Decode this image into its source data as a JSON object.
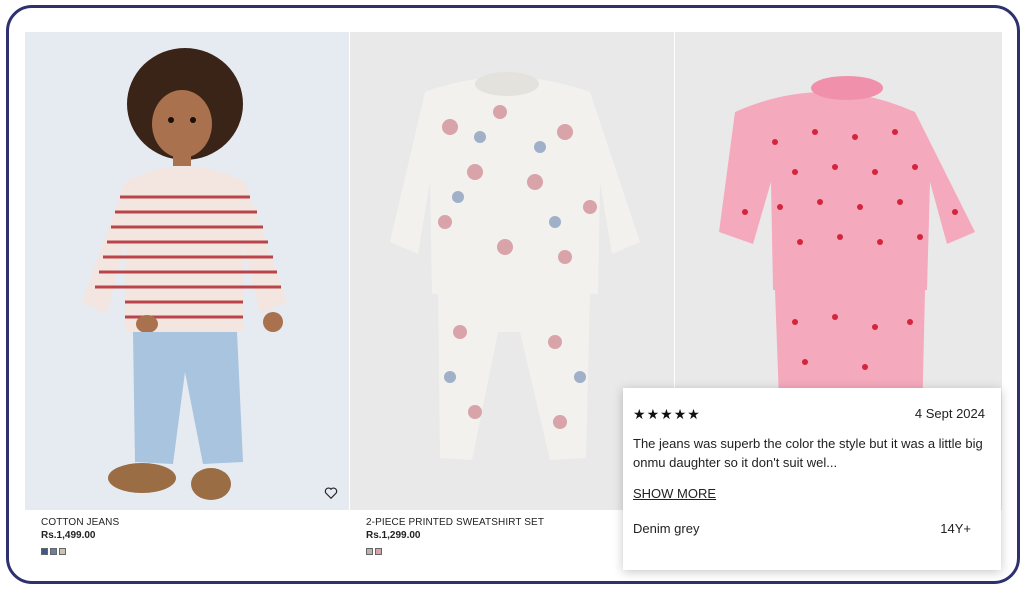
{
  "products": [
    {
      "name": "COTTON JEANS",
      "price": "Rs.1,499.00",
      "swatches": [
        "#3d5a8a",
        "#6a7fa6",
        "#c9c4b3"
      ],
      "photo_bg": "#e6eaf1"
    },
    {
      "name": "2-PIECE PRINTED SWEATSHIRT SET",
      "price": "Rs.1,299.00",
      "swatches": [
        "#b9b4b4",
        "#d9a3aa"
      ],
      "photo_bg": "#e9e9ea"
    },
    {
      "name": "",
      "price": "",
      "swatches": [],
      "photo_bg": "#e9e9ea"
    }
  ],
  "review": {
    "rating": 5,
    "star_glyph": "★",
    "date": "4 Sept 2024",
    "text": "The jeans was superb the color the style but it was a little big onmu daughter so it don't suit wel...",
    "show_more": "SHOW MORE",
    "variant": "Denim grey",
    "size": "14Y+"
  },
  "colors": {
    "frame_border": "#2e3170",
    "pink_set": "#f5a9bd",
    "heart_print": "#d4253c"
  },
  "icons": {
    "wishlist": "heart-outline-icon",
    "rating": "star-icon"
  }
}
